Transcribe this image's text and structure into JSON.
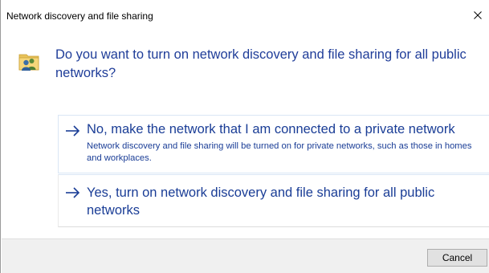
{
  "window": {
    "title": "Network discovery and file sharing",
    "close_icon": "close-icon"
  },
  "header": {
    "icon": "network-users-icon",
    "instruction": "Do you want to turn on network discovery and file sharing for all public networks?"
  },
  "options": [
    {
      "icon": "arrow-right-icon",
      "title": "No, make the network that I am connected to a private network",
      "description": "Network discovery and file sharing will be turned on for private networks, such as those in homes and workplaces."
    },
    {
      "icon": "arrow-right-icon",
      "title": "Yes, turn on network discovery and file sharing for all public networks"
    }
  ],
  "footer": {
    "cancel_label": "Cancel"
  },
  "colors": {
    "link_blue": "#1a3d96",
    "instruction_blue": "#1f3d99",
    "footer_bg": "#f0f0f0",
    "button_bg": "#e1e1e1"
  }
}
